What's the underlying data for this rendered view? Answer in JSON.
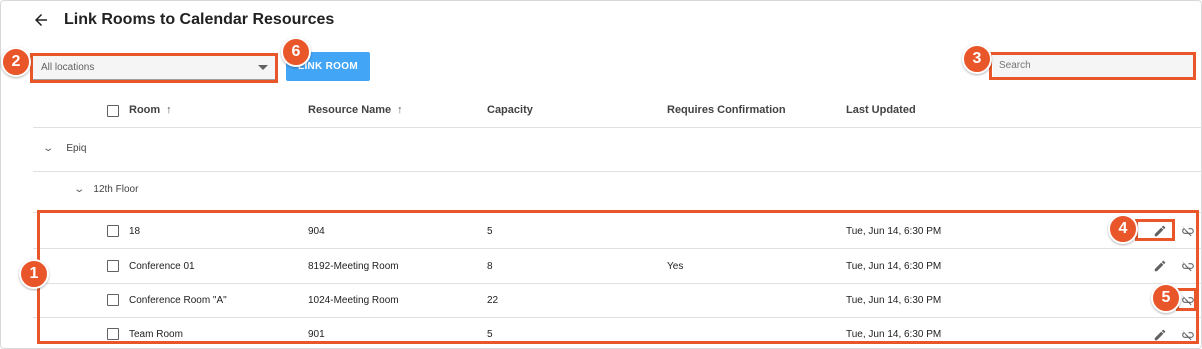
{
  "header": {
    "title": "Link Rooms to Calendar Resources"
  },
  "toolbar": {
    "location_value": "All locations",
    "link_room_label": "LINK ROOM",
    "search_placeholder": "Search"
  },
  "table": {
    "columns": {
      "room": "Room",
      "resource": "Resource Name",
      "capacity": "Capacity",
      "confirmation": "Requires Confirmation",
      "updated": "Last Updated"
    },
    "sort_glyph": "↑",
    "group": "Epiq",
    "subgroup": "12th Floor",
    "rows": [
      {
        "room": "18",
        "resource": "904",
        "capacity": "5",
        "confirmation": "",
        "updated": "Tue, Jun 14, 6:30 PM"
      },
      {
        "room": "Conference 01",
        "resource": "8192-Meeting Room",
        "capacity": "8",
        "confirmation": "Yes",
        "updated": "Tue, Jun 14, 6:30 PM"
      },
      {
        "room": "Conference Room \"A\"",
        "resource": "1024-Meeting Room",
        "capacity": "22",
        "confirmation": "",
        "updated": "Tue, Jun 14, 6:30 PM"
      },
      {
        "room": "Team Room",
        "resource": "901",
        "capacity": "5",
        "confirmation": "",
        "updated": "Tue, Jun 14, 6:30 PM"
      }
    ]
  },
  "callouts": [
    "1",
    "2",
    "3",
    "4",
    "5",
    "6"
  ],
  "colors": {
    "accent": "#42a5f5",
    "callout": "#e8562a"
  },
  "icons": [
    "back-arrow-icon",
    "caret-down-icon",
    "sort-up-icon",
    "chevron-down-icon",
    "edit-icon",
    "unlink-icon"
  ]
}
